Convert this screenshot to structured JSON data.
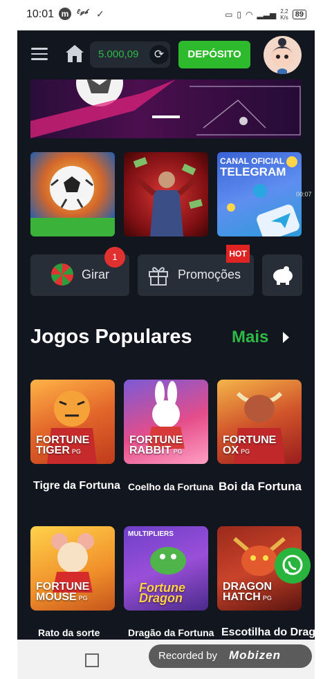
{
  "status_bar": {
    "time": "10:01",
    "icons_left": [
      "m-logo",
      "wifi-app-icon",
      "check-icon"
    ],
    "net_speed_top": "2,2",
    "net_speed_unit": "K/s",
    "battery": "89"
  },
  "header": {
    "balance": "5.000,09",
    "deposit_label": "DEPÓSITO"
  },
  "promo_tiles": [
    {
      "name": "football",
      "label": ""
    },
    {
      "name": "money-man",
      "label": ""
    },
    {
      "name": "telegram",
      "label_top": "CANAL OFICIAL",
      "label": "TELEGRAM"
    }
  ],
  "video_timer": "00:07",
  "quick_buttons": {
    "spin_label": "Girar",
    "spin_badge": "1",
    "promos_label": "Promoções",
    "promos_tag": "HOT"
  },
  "popular": {
    "title": "Jogos Populares",
    "more_label": "Mais",
    "games": [
      {
        "logo1": "FORTUNE",
        "logo2": "TIGER",
        "name": "Tigre da Fortuna"
      },
      {
        "logo1": "FORTUNE",
        "logo2": "RABBIT",
        "name": "Coelho da Fortuna"
      },
      {
        "logo1": "FORTUNE",
        "logo2": "OX",
        "name": "Boi da Fortuna"
      },
      {
        "logo1": "FORTUNE",
        "logo2": "MOUSE",
        "name": "Rato da sorte"
      },
      {
        "logo1": "Fortune",
        "logo2": "Dragon",
        "name": "Dragão da Fortuna",
        "tag": "MULTIPLIERS"
      },
      {
        "logo1": "DRAGON",
        "logo2": "HATCH",
        "name": "Escotilha do Drag"
      }
    ],
    "provider": "PG"
  },
  "recorder": {
    "text": "Recorded by",
    "brand": "Mobizen"
  },
  "colors": {
    "background": "#12161e",
    "accent_green": "#2dbb2d",
    "card": "#272e38"
  }
}
